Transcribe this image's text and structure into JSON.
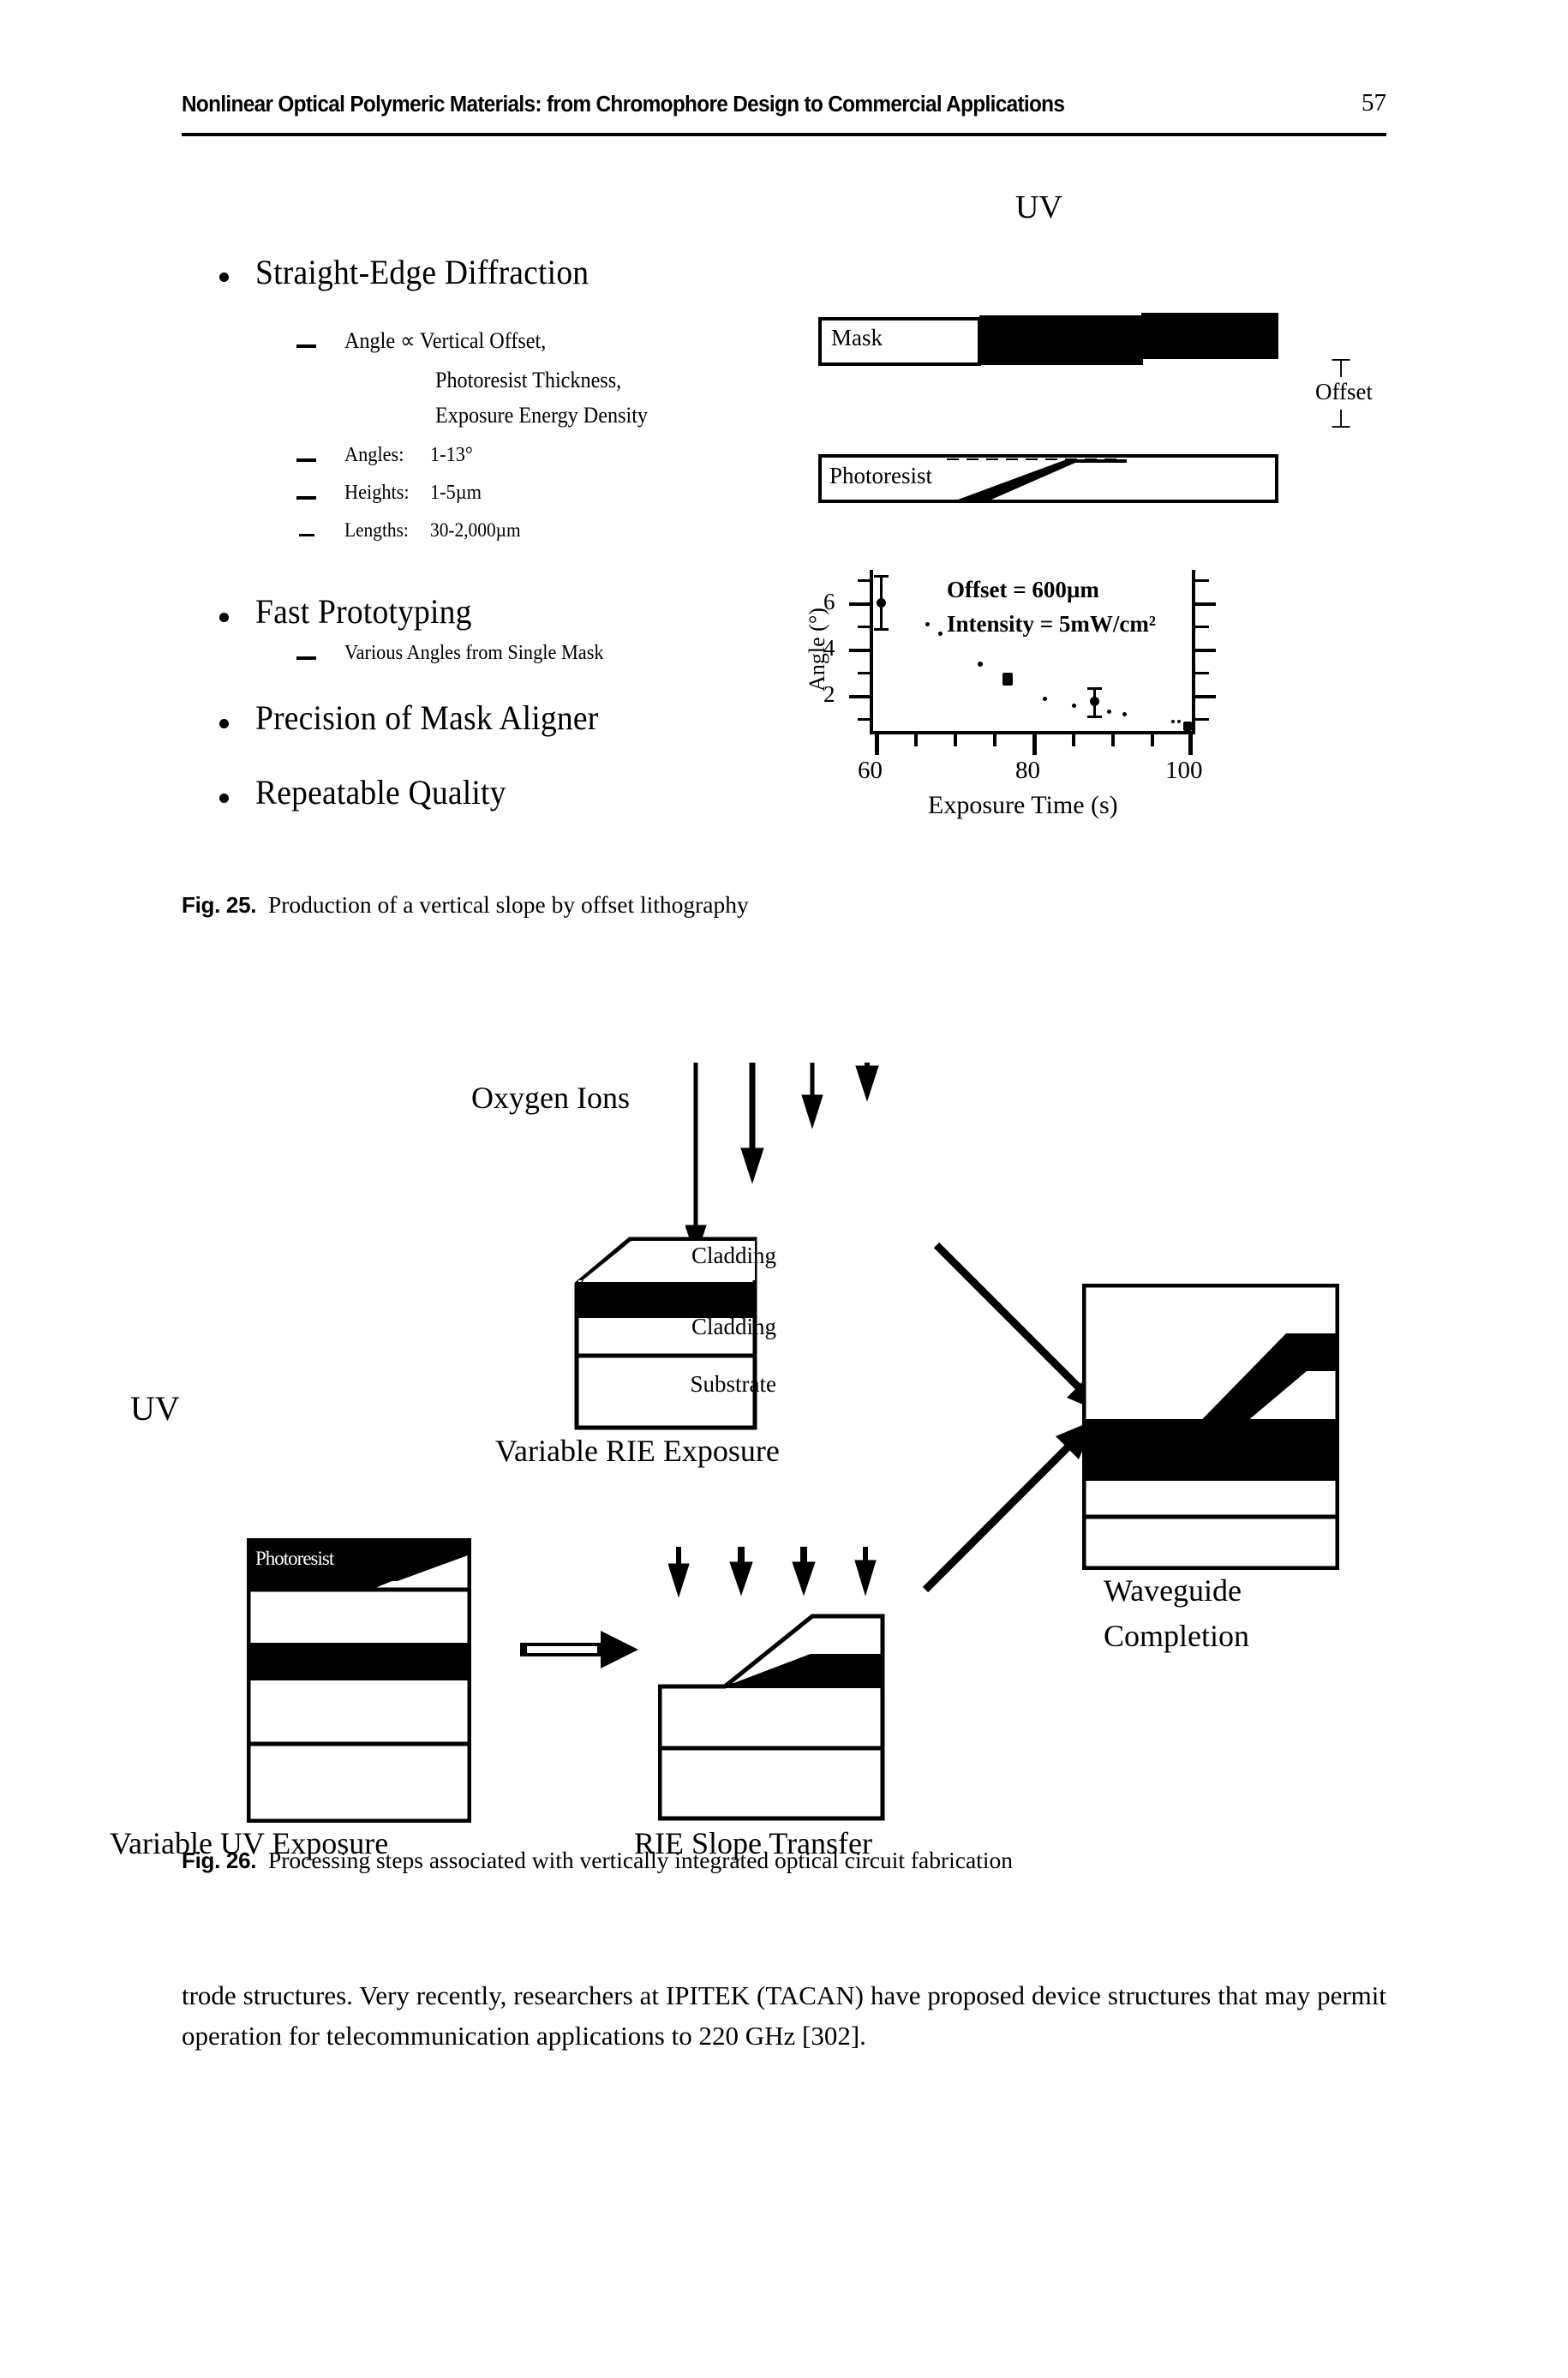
{
  "header": {
    "title": "Nonlinear Optical Polymeric Materials: from Chromophore Design to Commercial Applications",
    "page_number": "57"
  },
  "slide_bullets": {
    "b1": "Straight-Edge Diffraction",
    "b1_sub1_l1": "Angle ∝ Vertical Offset,",
    "b1_sub1_l2": "Photoresist Thickness,",
    "b1_sub1_l3": "Exposure Energy Density",
    "b1_sub2_label": "Angles:",
    "b1_sub2_value": "1-13°",
    "b1_sub3_label": "Heights:",
    "b1_sub3_value": "1-5µm",
    "b1_sub4_label": "Lengths:",
    "b1_sub4_value": "30-2,000µm",
    "b2": "Fast Prototyping",
    "b2_sub1": "Various Angles from Single Mask",
    "b3": "Precision of Mask Aligner",
    "b4": "Repeatable Quality"
  },
  "fig25_art": {
    "uv_label": "UV",
    "mask_label": "Mask",
    "photoresist_label": "Photoresist",
    "offset_label": "Offset"
  },
  "chart_data": {
    "type": "scatter",
    "title": "",
    "xlabel": "Exposure Time (s)",
    "ylabel": "Angle (°)",
    "xlim": [
      55,
      104
    ],
    "ylim": [
      0,
      7
    ],
    "xticks": [
      60,
      80,
      100
    ],
    "xtick_labels": [
      "60",
      "80",
      "100"
    ],
    "yticks": [
      2,
      4,
      6
    ],
    "ytick_labels": [
      "2",
      "4",
      "6"
    ],
    "grid": false,
    "legend": "none",
    "annotations": [
      "Offset = 600µm",
      "Intensity = 5mW/cm²"
    ],
    "x": [
      60,
      75,
      88,
      100
    ],
    "y": [
      6.1,
      3.2,
      2.0,
      1.0
    ],
    "yerr": [
      0.95,
      0.0,
      0.5,
      0.0
    ]
  },
  "fig25_caption": {
    "number": "Fig. 25.",
    "text": "Production of a vertical slope by offset lithography"
  },
  "fig26_art": {
    "oxygen_ions_label": "Oxygen Ions",
    "uv_label": "UV",
    "rie_cladding_top": "Cladding",
    "rie_cladding_bottom": "Cladding",
    "rie_substrate": "Substrate",
    "step_rie": "Variable RIE Exposure",
    "step_uv": "Variable UV Exposure",
    "step_transfer": "RIE Slope Transfer",
    "step_waveguide_line1": "Waveguide",
    "step_waveguide_line2": "Completion",
    "photoresist_label": "Photoresist"
  },
  "fig26_caption": {
    "number": "Fig. 26.",
    "text": "Processing steps associated with vertically integrated optical circuit fabrication"
  },
  "body": {
    "paragraph": "trode structures. Very recently, researchers at IPITEK (TACAN) have proposed device structures that may permit operation for telecommunication applications to 220 GHz [302]."
  }
}
